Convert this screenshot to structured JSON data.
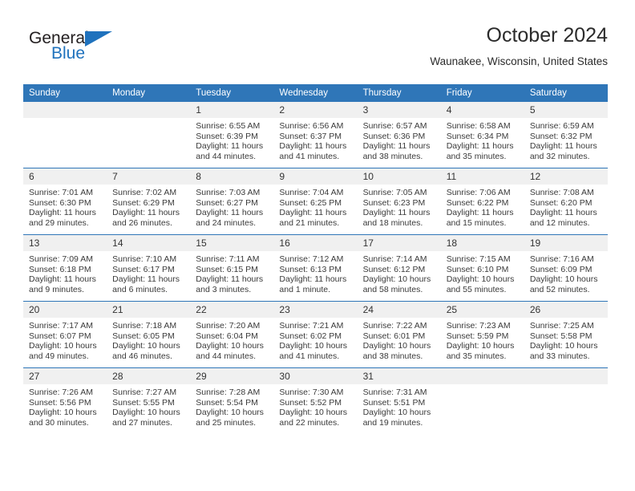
{
  "brand": {
    "name_part1": "General",
    "name_part2": "Blue",
    "logo_icon": "triangle-flag-icon",
    "accent_color": "#1f72bd"
  },
  "header": {
    "month_title": "October 2024",
    "location": "Waunakee, Wisconsin, United States"
  },
  "calendar": {
    "header_color": "#2f76b8",
    "daynum_bg": "#f0f0f0",
    "weekdays": [
      "Sunday",
      "Monday",
      "Tuesday",
      "Wednesday",
      "Thursday",
      "Friday",
      "Saturday"
    ],
    "weeks": [
      [
        {
          "day": "",
          "blank": true
        },
        {
          "day": "",
          "blank": true
        },
        {
          "day": "1",
          "sunrise": "Sunrise: 6:55 AM",
          "sunset": "Sunset: 6:39 PM",
          "daylight_l1": "Daylight: 11 hours",
          "daylight_l2": "and 44 minutes."
        },
        {
          "day": "2",
          "sunrise": "Sunrise: 6:56 AM",
          "sunset": "Sunset: 6:37 PM",
          "daylight_l1": "Daylight: 11 hours",
          "daylight_l2": "and 41 minutes."
        },
        {
          "day": "3",
          "sunrise": "Sunrise: 6:57 AM",
          "sunset": "Sunset: 6:36 PM",
          "daylight_l1": "Daylight: 11 hours",
          "daylight_l2": "and 38 minutes."
        },
        {
          "day": "4",
          "sunrise": "Sunrise: 6:58 AM",
          "sunset": "Sunset: 6:34 PM",
          "daylight_l1": "Daylight: 11 hours",
          "daylight_l2": "and 35 minutes."
        },
        {
          "day": "5",
          "sunrise": "Sunrise: 6:59 AM",
          "sunset": "Sunset: 6:32 PM",
          "daylight_l1": "Daylight: 11 hours",
          "daylight_l2": "and 32 minutes."
        }
      ],
      [
        {
          "day": "6",
          "sunrise": "Sunrise: 7:01 AM",
          "sunset": "Sunset: 6:30 PM",
          "daylight_l1": "Daylight: 11 hours",
          "daylight_l2": "and 29 minutes."
        },
        {
          "day": "7",
          "sunrise": "Sunrise: 7:02 AM",
          "sunset": "Sunset: 6:29 PM",
          "daylight_l1": "Daylight: 11 hours",
          "daylight_l2": "and 26 minutes."
        },
        {
          "day": "8",
          "sunrise": "Sunrise: 7:03 AM",
          "sunset": "Sunset: 6:27 PM",
          "daylight_l1": "Daylight: 11 hours",
          "daylight_l2": "and 24 minutes."
        },
        {
          "day": "9",
          "sunrise": "Sunrise: 7:04 AM",
          "sunset": "Sunset: 6:25 PM",
          "daylight_l1": "Daylight: 11 hours",
          "daylight_l2": "and 21 minutes."
        },
        {
          "day": "10",
          "sunrise": "Sunrise: 7:05 AM",
          "sunset": "Sunset: 6:23 PM",
          "daylight_l1": "Daylight: 11 hours",
          "daylight_l2": "and 18 minutes."
        },
        {
          "day": "11",
          "sunrise": "Sunrise: 7:06 AM",
          "sunset": "Sunset: 6:22 PM",
          "daylight_l1": "Daylight: 11 hours",
          "daylight_l2": "and 15 minutes."
        },
        {
          "day": "12",
          "sunrise": "Sunrise: 7:08 AM",
          "sunset": "Sunset: 6:20 PM",
          "daylight_l1": "Daylight: 11 hours",
          "daylight_l2": "and 12 minutes."
        }
      ],
      [
        {
          "day": "13",
          "sunrise": "Sunrise: 7:09 AM",
          "sunset": "Sunset: 6:18 PM",
          "daylight_l1": "Daylight: 11 hours",
          "daylight_l2": "and 9 minutes."
        },
        {
          "day": "14",
          "sunrise": "Sunrise: 7:10 AM",
          "sunset": "Sunset: 6:17 PM",
          "daylight_l1": "Daylight: 11 hours",
          "daylight_l2": "and 6 minutes."
        },
        {
          "day": "15",
          "sunrise": "Sunrise: 7:11 AM",
          "sunset": "Sunset: 6:15 PM",
          "daylight_l1": "Daylight: 11 hours",
          "daylight_l2": "and 3 minutes."
        },
        {
          "day": "16",
          "sunrise": "Sunrise: 7:12 AM",
          "sunset": "Sunset: 6:13 PM",
          "daylight_l1": "Daylight: 11 hours",
          "daylight_l2": "and 1 minute."
        },
        {
          "day": "17",
          "sunrise": "Sunrise: 7:14 AM",
          "sunset": "Sunset: 6:12 PM",
          "daylight_l1": "Daylight: 10 hours",
          "daylight_l2": "and 58 minutes."
        },
        {
          "day": "18",
          "sunrise": "Sunrise: 7:15 AM",
          "sunset": "Sunset: 6:10 PM",
          "daylight_l1": "Daylight: 10 hours",
          "daylight_l2": "and 55 minutes."
        },
        {
          "day": "19",
          "sunrise": "Sunrise: 7:16 AM",
          "sunset": "Sunset: 6:09 PM",
          "daylight_l1": "Daylight: 10 hours",
          "daylight_l2": "and 52 minutes."
        }
      ],
      [
        {
          "day": "20",
          "sunrise": "Sunrise: 7:17 AM",
          "sunset": "Sunset: 6:07 PM",
          "daylight_l1": "Daylight: 10 hours",
          "daylight_l2": "and 49 minutes."
        },
        {
          "day": "21",
          "sunrise": "Sunrise: 7:18 AM",
          "sunset": "Sunset: 6:05 PM",
          "daylight_l1": "Daylight: 10 hours",
          "daylight_l2": "and 46 minutes."
        },
        {
          "day": "22",
          "sunrise": "Sunrise: 7:20 AM",
          "sunset": "Sunset: 6:04 PM",
          "daylight_l1": "Daylight: 10 hours",
          "daylight_l2": "and 44 minutes."
        },
        {
          "day": "23",
          "sunrise": "Sunrise: 7:21 AM",
          "sunset": "Sunset: 6:02 PM",
          "daylight_l1": "Daylight: 10 hours",
          "daylight_l2": "and 41 minutes."
        },
        {
          "day": "24",
          "sunrise": "Sunrise: 7:22 AM",
          "sunset": "Sunset: 6:01 PM",
          "daylight_l1": "Daylight: 10 hours",
          "daylight_l2": "and 38 minutes."
        },
        {
          "day": "25",
          "sunrise": "Sunrise: 7:23 AM",
          "sunset": "Sunset: 5:59 PM",
          "daylight_l1": "Daylight: 10 hours",
          "daylight_l2": "and 35 minutes."
        },
        {
          "day": "26",
          "sunrise": "Sunrise: 7:25 AM",
          "sunset": "Sunset: 5:58 PM",
          "daylight_l1": "Daylight: 10 hours",
          "daylight_l2": "and 33 minutes."
        }
      ],
      [
        {
          "day": "27",
          "sunrise": "Sunrise: 7:26 AM",
          "sunset": "Sunset: 5:56 PM",
          "daylight_l1": "Daylight: 10 hours",
          "daylight_l2": "and 30 minutes."
        },
        {
          "day": "28",
          "sunrise": "Sunrise: 7:27 AM",
          "sunset": "Sunset: 5:55 PM",
          "daylight_l1": "Daylight: 10 hours",
          "daylight_l2": "and 27 minutes."
        },
        {
          "day": "29",
          "sunrise": "Sunrise: 7:28 AM",
          "sunset": "Sunset: 5:54 PM",
          "daylight_l1": "Daylight: 10 hours",
          "daylight_l2": "and 25 minutes."
        },
        {
          "day": "30",
          "sunrise": "Sunrise: 7:30 AM",
          "sunset": "Sunset: 5:52 PM",
          "daylight_l1": "Daylight: 10 hours",
          "daylight_l2": "and 22 minutes."
        },
        {
          "day": "31",
          "sunrise": "Sunrise: 7:31 AM",
          "sunset": "Sunset: 5:51 PM",
          "daylight_l1": "Daylight: 10 hours",
          "daylight_l2": "and 19 minutes."
        },
        {
          "day": "",
          "blank": true
        },
        {
          "day": "",
          "blank": true
        }
      ]
    ]
  }
}
